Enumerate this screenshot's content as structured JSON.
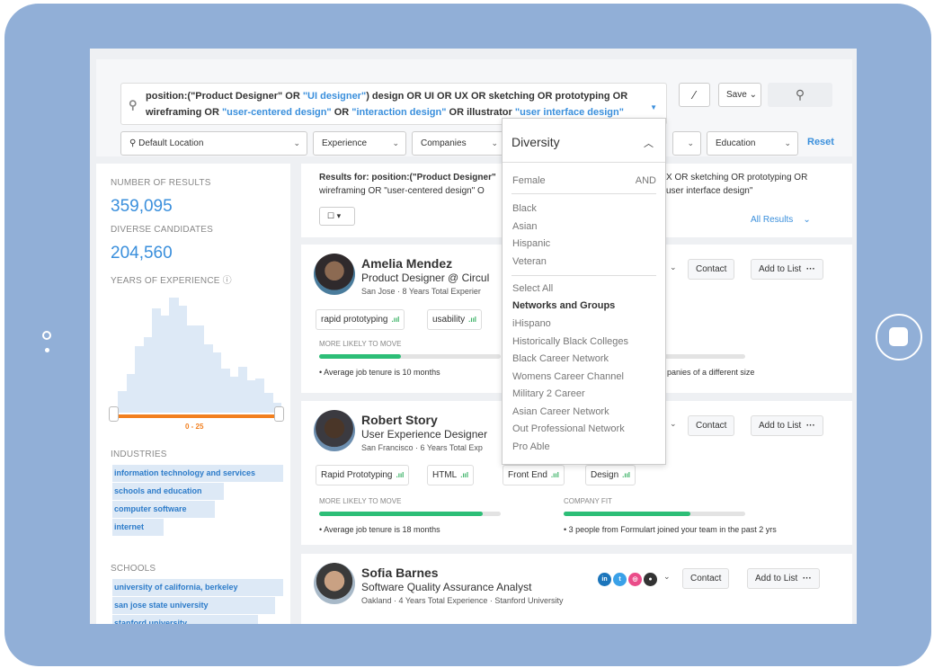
{
  "search": {
    "query_parts": [
      "position:(\"Product Designer\"",
      " OR ",
      "\"UI designer\"",
      ") design ",
      "OR",
      " UI ",
      "OR",
      " UX ",
      "OR",
      " sketching ",
      "OR",
      " prototyping ",
      "OR",
      " wireframing ",
      "OR",
      " \"user-centered design\"",
      " OR ",
      "\"interaction design\"",
      " OR ",
      "illustrator ",
      "\"user interface design\""
    ],
    "save_label": "Save"
  },
  "filters": {
    "location": "Default Location",
    "experience": "Experience",
    "companies": "Companies",
    "education": "Education",
    "reset": "Reset"
  },
  "diversity": {
    "title": "Diversity",
    "and_label": "AND",
    "items": [
      "Female",
      "Black",
      "Asian",
      "Hispanic",
      "Veteran",
      "Select All",
      "Networks and Groups",
      "iHispano",
      "Historically Black Colleges",
      "Black Career Network",
      "Womens Career Channel",
      "Military 2 Career",
      "Asian Career Network",
      "Out Professional Network",
      "Pro Able"
    ]
  },
  "stats": {
    "results_label": "NUMBER OF RESULTS",
    "results_value": "359,095",
    "diverse_label": "DIVERSE CANDIDATES",
    "diverse_value": "204,560",
    "years_label": "YEARS OF EXPERIENCE",
    "range_label": "0 - 25",
    "histogram": [
      0.18,
      0.32,
      0.55,
      0.62,
      0.86,
      0.8,
      0.95,
      0.88,
      0.72,
      0.72,
      0.56,
      0.5,
      0.36,
      0.3,
      0.38,
      0.27,
      0.28,
      0.16,
      0.08
    ]
  },
  "industries": {
    "label": "INDUSTRIES",
    "items": [
      {
        "name": "information technology and services",
        "share": 1.0
      },
      {
        "name": "schools and education",
        "share": 0.65
      },
      {
        "name": "computer software",
        "share": 0.6
      },
      {
        "name": "internet",
        "share": 0.3
      }
    ]
  },
  "schools": {
    "label": "SCHOOLS",
    "items": [
      {
        "name": "university of california, berkeley",
        "share": 1.0
      },
      {
        "name": "san jose state university",
        "share": 0.95
      },
      {
        "name": "stanford university",
        "share": 0.85
      }
    ]
  },
  "results_header": {
    "line1": "Results for:  position:(\"Product Designer\"",
    "line1_right": "X OR sketching OR prototyping OR",
    "line2": "wireframing OR \"user-centered design\" O",
    "line2_right": "user interface design\"",
    "all_results": "All Results"
  },
  "candidates": [
    {
      "name": "Amelia Mendez",
      "title": "Product Designer @ Circul",
      "sub": "San Jose ·  8 Years Total Experier",
      "tags": [
        "rapid prototyping",
        "usability"
      ],
      "move_label": "MORE LIKELY TO MOVE",
      "move_level": 0.45,
      "tenure": "Average job tenure is 10 months",
      "fit_text": "panies of a different size",
      "contact": "Contact",
      "add": "Add to List"
    },
    {
      "name": "Robert Story",
      "title": "User Experience Designer",
      "sub": "San Francisco ·  6 Years Total Exp",
      "tags": [
        "Rapid Prototyping",
        "HTML",
        "Front End",
        "Design"
      ],
      "move_label": "MORE LIKELY TO MOVE",
      "move_level": 0.9,
      "fit_label": "COMPANY FIT",
      "fit_level": 0.7,
      "tenure": "Average job tenure is 18 months",
      "fit_text": "3 people from Formulart joined your team in the past 2 yrs",
      "contact": "Contact",
      "add": "Add to List"
    },
    {
      "name": "Sofia Barnes",
      "title": "Software Quality Assurance Analyst",
      "sub": "Oakland ·  4 Years Total Experience ·  Stanford University",
      "contact": "Contact",
      "add": "Add to List"
    }
  ],
  "colors": {
    "accent": "#3a8fdc",
    "orange": "#f27f1e",
    "green": "#2dbe77",
    "frame": "#91afd7"
  }
}
